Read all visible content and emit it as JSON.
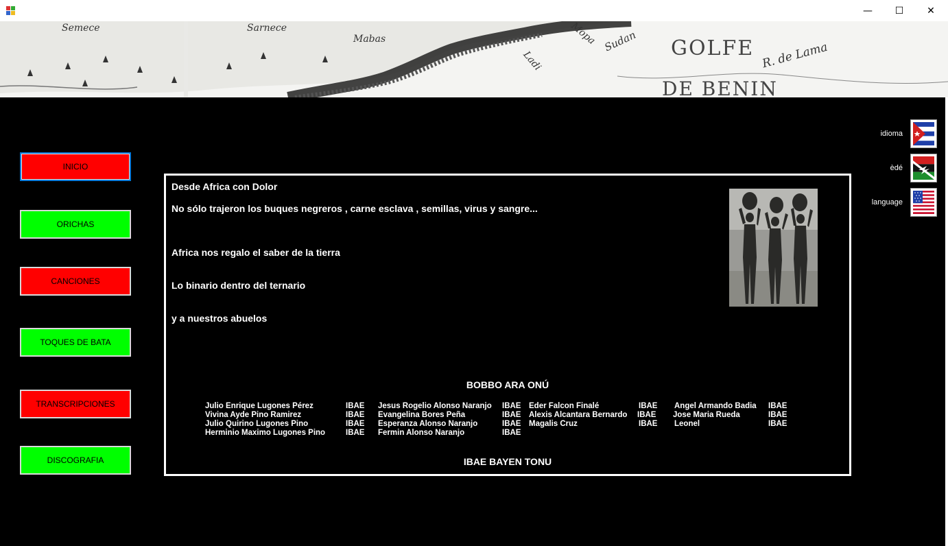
{
  "window": {
    "minimize_glyph": "—",
    "maximize_glyph": "☐",
    "close_glyph": "✕"
  },
  "banner": {
    "map_labels": [
      "Semece",
      "Sarnece",
      "Mabas",
      "Ladi",
      "Mopa",
      "Sudan",
      "GOLFE",
      "R. de Lama",
      "DE BENIN"
    ]
  },
  "nav": {
    "items": [
      {
        "label": "INICIO",
        "color": "#ff0000"
      },
      {
        "label": "ORICHAS",
        "color": "#00ff00"
      },
      {
        "label": "CANCIONES",
        "color": "#ff0000"
      },
      {
        "label": "TOQUES DE BATA",
        "color": "#00ff00"
      },
      {
        "label": "TRANSCRIPCIONES",
        "color": "#ff0000"
      },
      {
        "label": "DISCOGRAFIA",
        "color": "#00ff00"
      }
    ]
  },
  "content": {
    "title": "Desde Africa con Dolor",
    "line1": "No sólo trajeron los buques negreros , carne esclava , semillas, virus y sangre...",
    "line2": "Africa nos regalo el saber de la tierra",
    "line3": "Lo binario dentro del ternario",
    "line4": "y a nuestros abuelos",
    "credits_heading": "BOBBO ARA ONÚ",
    "credits_footer": "IBAE BAYEN TONU",
    "credits": [
      [
        "Julio Enrique Lugones Pérez",
        "IBAE",
        "Jesus Rogelio Alonso Naranjo",
        "IBAE",
        "Eder Falcon Finalé",
        "IBAE",
        "Angel Armando Badia",
        "IBAE"
      ],
      [
        "Vivina Ayde Pino Ramirez",
        "IBAE",
        "Evangelina Bores Peña",
        "IBAE",
        "Alexis Alcantara Bernardo",
        "IBAE",
        "Jose Maria Rueda",
        "IBAE"
      ],
      [
        "Julio Quirino Lugones Pino",
        "IBAE",
        "Esperanza Alonso Naranjo",
        "IBAE",
        "Magalis Cruz",
        "IBAE",
        "Leonel",
        "IBAE"
      ],
      [
        "Herminio Maximo Lugones Pino",
        "IBAE",
        "Fermin Alonso Naranjo",
        "IBAE",
        "",
        "",
        "",
        ""
      ]
    ]
  },
  "languages": [
    {
      "label": "idioma",
      "flag": "cuba-flag-icon"
    },
    {
      "label": "èdé",
      "flag": "african-flag-icon"
    },
    {
      "label": "language",
      "flag": "usa-flag-icon"
    }
  ],
  "colors": {
    "red_button": "#ff0000",
    "green_button": "#00ff00",
    "background": "#000000",
    "active_border": "#0078d7"
  }
}
